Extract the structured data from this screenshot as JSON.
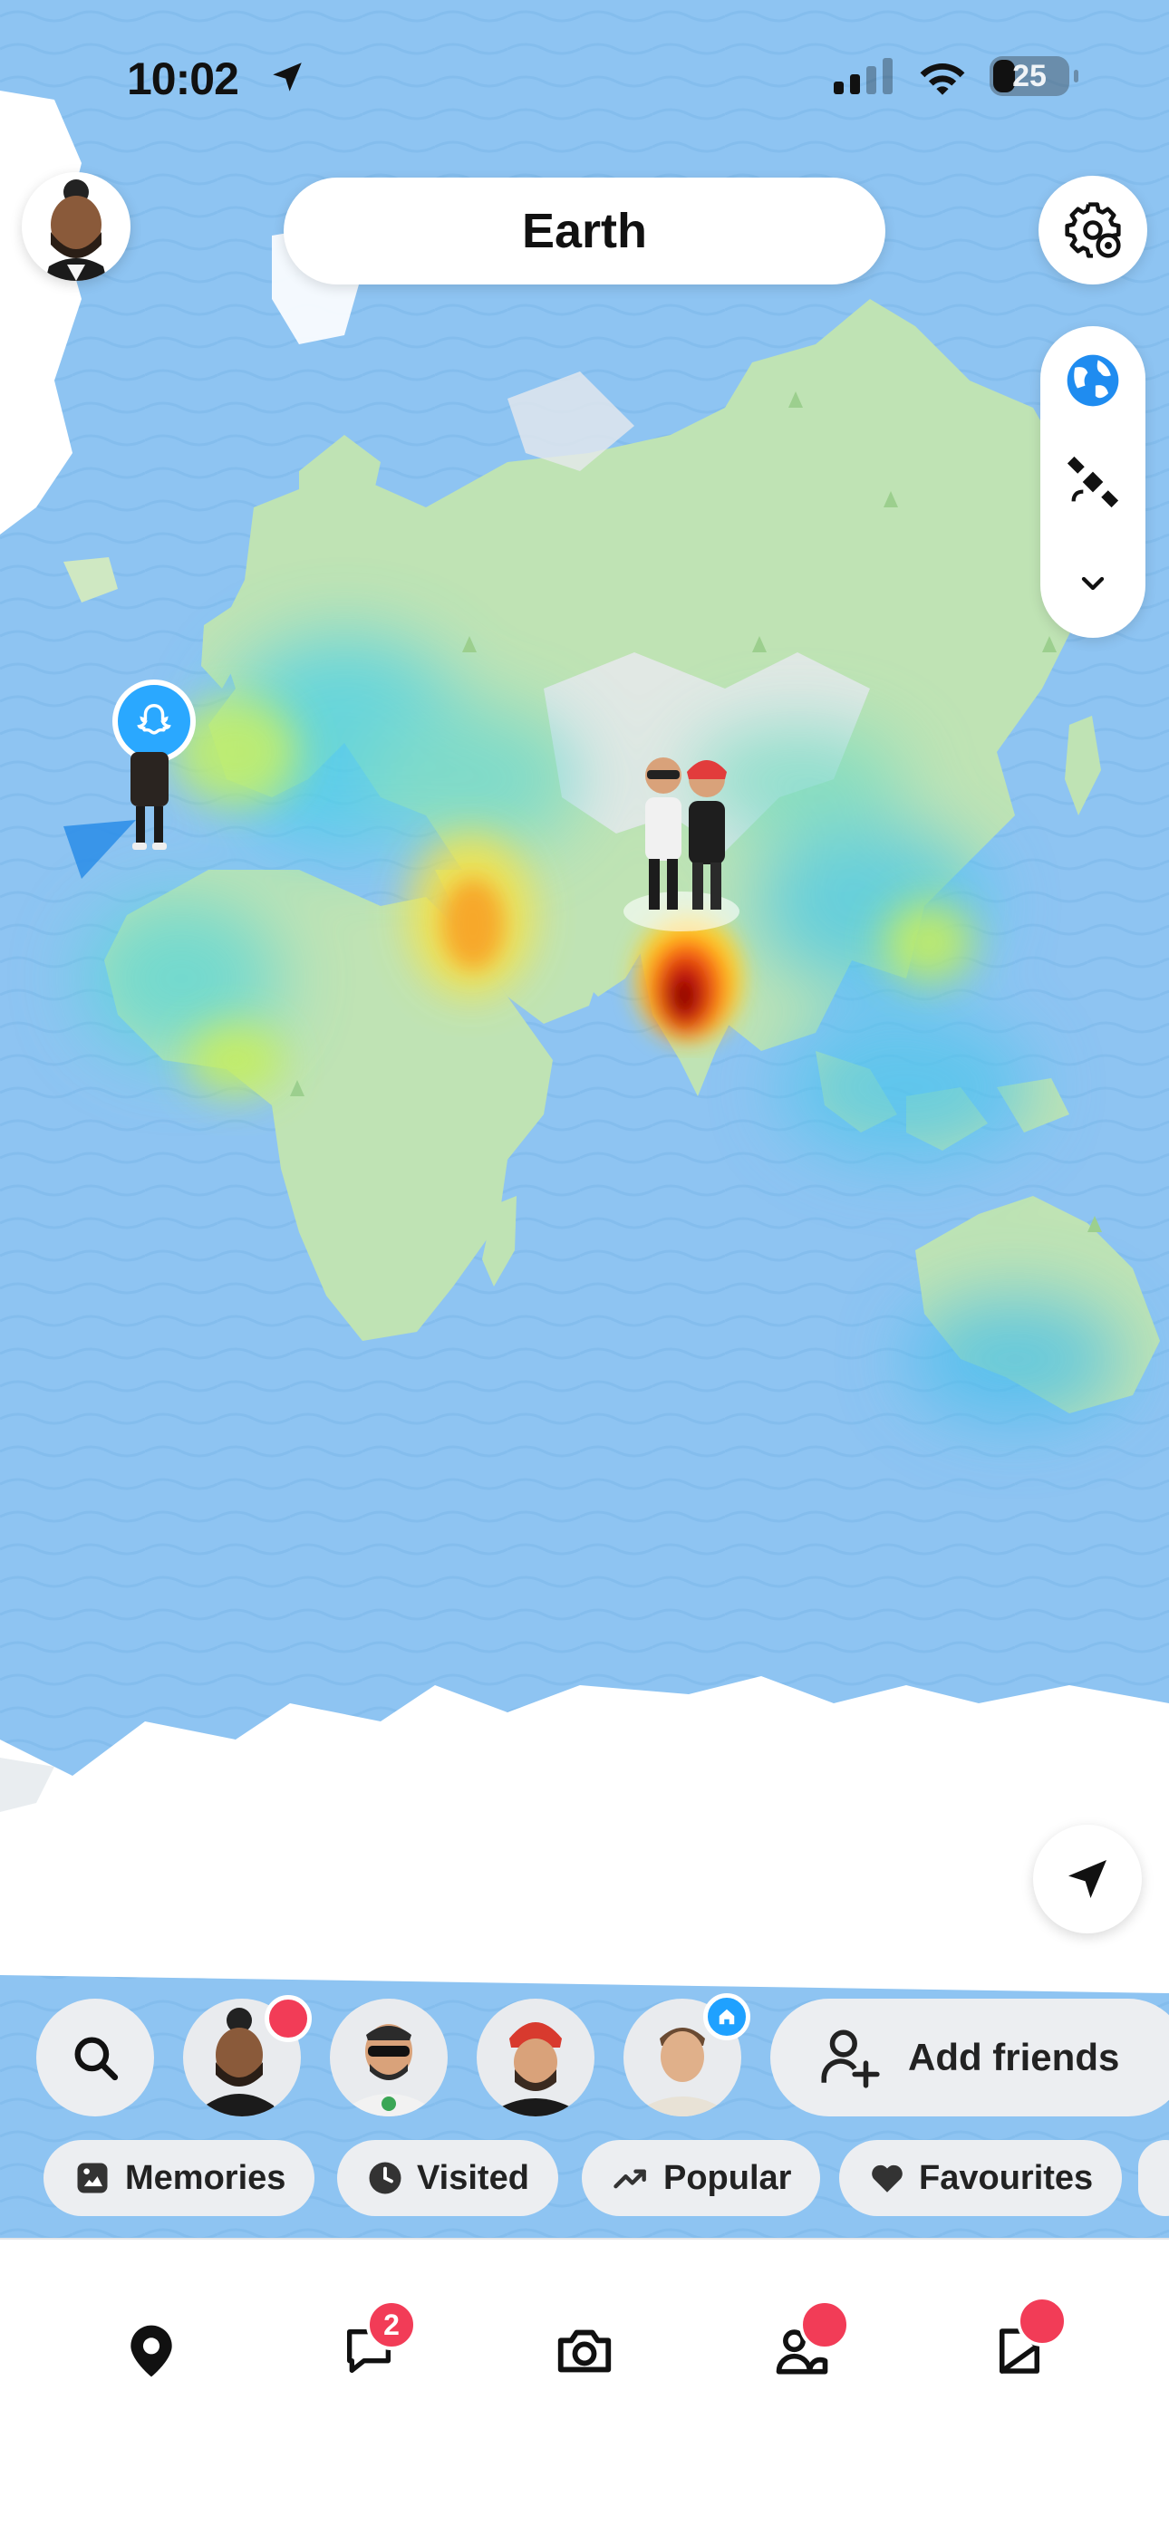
{
  "status": {
    "time": "10:02",
    "battery": "25"
  },
  "map": {
    "title": "Earth"
  },
  "friends": {
    "add_label": "Add friends"
  },
  "chips": [
    {
      "label": "Memories",
      "icon": "memories-icon"
    },
    {
      "label": "Visited",
      "icon": "clock-icon"
    },
    {
      "label": "Popular",
      "icon": "trending-icon"
    },
    {
      "label": "Favourites",
      "icon": "heart-icon"
    }
  ],
  "nav": {
    "chat_badge": "2"
  },
  "colors": {
    "ocean": "#8ec4f2",
    "land": "#bfe3b4",
    "heat_hot": "#c80a0a",
    "badge": "#f23c57",
    "accent": "#1fa1ff"
  }
}
